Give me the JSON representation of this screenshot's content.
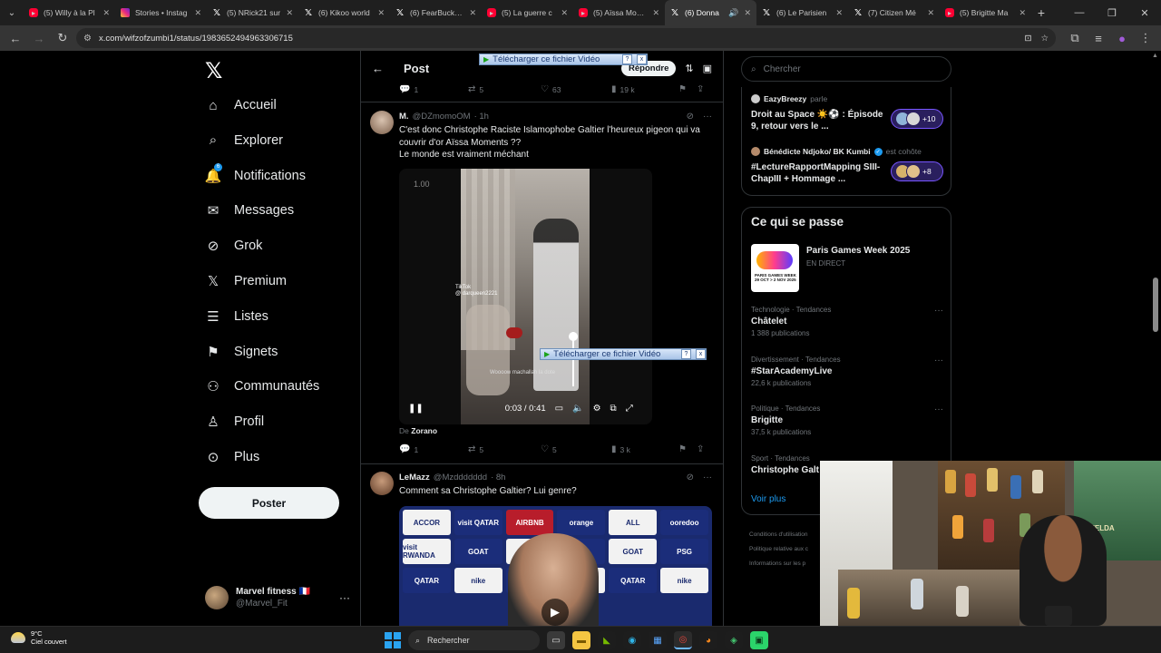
{
  "browser": {
    "tabs": [
      {
        "title": "(5) Willy à la Pl",
        "type": "yt"
      },
      {
        "title": "Stories • Instag",
        "type": "ig"
      },
      {
        "title": "(5) NRick21 sur",
        "type": "x"
      },
      {
        "title": "(6) Kikoo world",
        "type": "x"
      },
      {
        "title": "(6) FearBuck sur",
        "type": "x"
      },
      {
        "title": "(5) La guerre c",
        "type": "yt"
      },
      {
        "title": "(5) Aïssa Mome",
        "type": "yt"
      },
      {
        "title": "(6) Donna",
        "type": "x",
        "active": true
      },
      {
        "title": "(6) Le Parisien",
        "type": "x"
      },
      {
        "title": "(7) Citizen Mé",
        "type": "x"
      },
      {
        "title": "(5) Brigitte Ma",
        "type": "yt"
      }
    ],
    "url": "x.com/wifzofzumbi1/status/1983652494963306715"
  },
  "nav": {
    "items": [
      {
        "label": "Accueil",
        "icon": "home-icon",
        "glyph": "⌂"
      },
      {
        "label": "Explorer",
        "icon": "search-icon",
        "glyph": "⌕"
      },
      {
        "label": "Notifications",
        "icon": "bell-icon",
        "glyph": "🔔"
      },
      {
        "label": "Messages",
        "icon": "mail-icon",
        "glyph": "✉"
      },
      {
        "label": "Grok",
        "icon": "grok-icon",
        "glyph": "⊘"
      },
      {
        "label": "Premium",
        "icon": "x-logo-icon",
        "glyph": "𝕏"
      },
      {
        "label": "Listes",
        "icon": "list-icon",
        "glyph": "☰"
      },
      {
        "label": "Signets",
        "icon": "bookmark-icon",
        "glyph": "⚑"
      },
      {
        "label": "Communautés",
        "icon": "communities-icon",
        "glyph": "⚇"
      },
      {
        "label": "Profil",
        "icon": "profile-icon",
        "glyph": "♙"
      },
      {
        "label": "Plus",
        "icon": "more-circle-icon",
        "glyph": "⊙"
      }
    ],
    "notif_badge": "6",
    "post_button": "Poster",
    "account": {
      "name": "Marvel fitness 🇫🇷",
      "handle": "@Marvel_Fit"
    }
  },
  "header": {
    "title": "Post",
    "reply": "Répondre"
  },
  "prev_actions": {
    "replies": "1",
    "reposts": "5",
    "likes": "63",
    "views": "19 k"
  },
  "tweet1": {
    "name": "M.",
    "handle": "@DZmomoOM",
    "time": "· 1h",
    "line1": "C'est donc Christophe Raciste Islamophobe Galtier l'heureux pigeon qui va",
    "line2": "couvrir d'or Aïssa Moments ??",
    "line3": "Le monde est vraiment méchant",
    "video": {
      "speed": "1.00",
      "time": "0:03 / 0:41",
      "tiktok": "TikTok",
      "tiktok_handle": "@ darqueen2221",
      "caption": "Woooow machallah la dote"
    },
    "from_prefix": "De",
    "from_name": "Zorano",
    "actions": {
      "replies": "1",
      "reposts": "5",
      "likes": "5",
      "views": "3 k"
    }
  },
  "download_bar": {
    "label": "Télécharger ce fichier Vidéo",
    "help": "?",
    "close": "x"
  },
  "tweet2": {
    "name": "LeMazz",
    "handle": "@Mzddddddd",
    "time": "· 8h",
    "text": "Comment sa Christophe Galtier?  Lui genre?",
    "sponsors": [
      "ACCOR",
      "visit QATAR",
      "AIRBNB",
      "orange",
      "ALL",
      "ooredoo",
      "visit RWANDA",
      "GOAT",
      "PSG",
      "nike",
      "GOAT",
      "PSG",
      "QATAR",
      "nike",
      "",
      "",
      "QATAR",
      "nike"
    ]
  },
  "right": {
    "search_placeholder": "Chercher",
    "spaces": [
      {
        "host": "EazyBreezy",
        "suffix": "parle",
        "title": "Droit au Space ☀️⚽ : Épisode 9, retour vers le ...",
        "count": "+10"
      },
      {
        "host": "Bénédicte Ndjoko/ BK Kumbi",
        "suffix": "est cohôte",
        "title": "#LectureRapportMapping SIII-ChapIII  + Hommage ...",
        "count": "+8"
      }
    ],
    "happening_title": "Ce qui se passe",
    "event": {
      "title": "Paris Games Week 2025",
      "sub": "EN DIRECT",
      "img_text": "PARIS GAMES WEEK  29 OCT > 2 NOV 2025"
    },
    "trends": [
      {
        "cat": "Technologie · Tendances",
        "name": "Châtelet",
        "count": "1 388 publications"
      },
      {
        "cat": "Divertissement · Tendances",
        "name": "#StarAcademyLive",
        "count": "22,6 k publications"
      },
      {
        "cat": "Politique · Tendances",
        "name": "Brigitte",
        "count": "37,5 k publications"
      },
      {
        "cat": "Sport · Tendances",
        "name": "Christophe Galt",
        "count": ""
      }
    ],
    "see_more": "Voir plus",
    "footer": [
      "Conditions d'utilisation",
      "Politique relative aux c",
      "Informations sur les p"
    ]
  },
  "taskbar": {
    "temp": "9°C",
    "weather": "Ciel couvert",
    "search": "Rechercher"
  },
  "webcam": {
    "poster_text": "ZELDA"
  }
}
